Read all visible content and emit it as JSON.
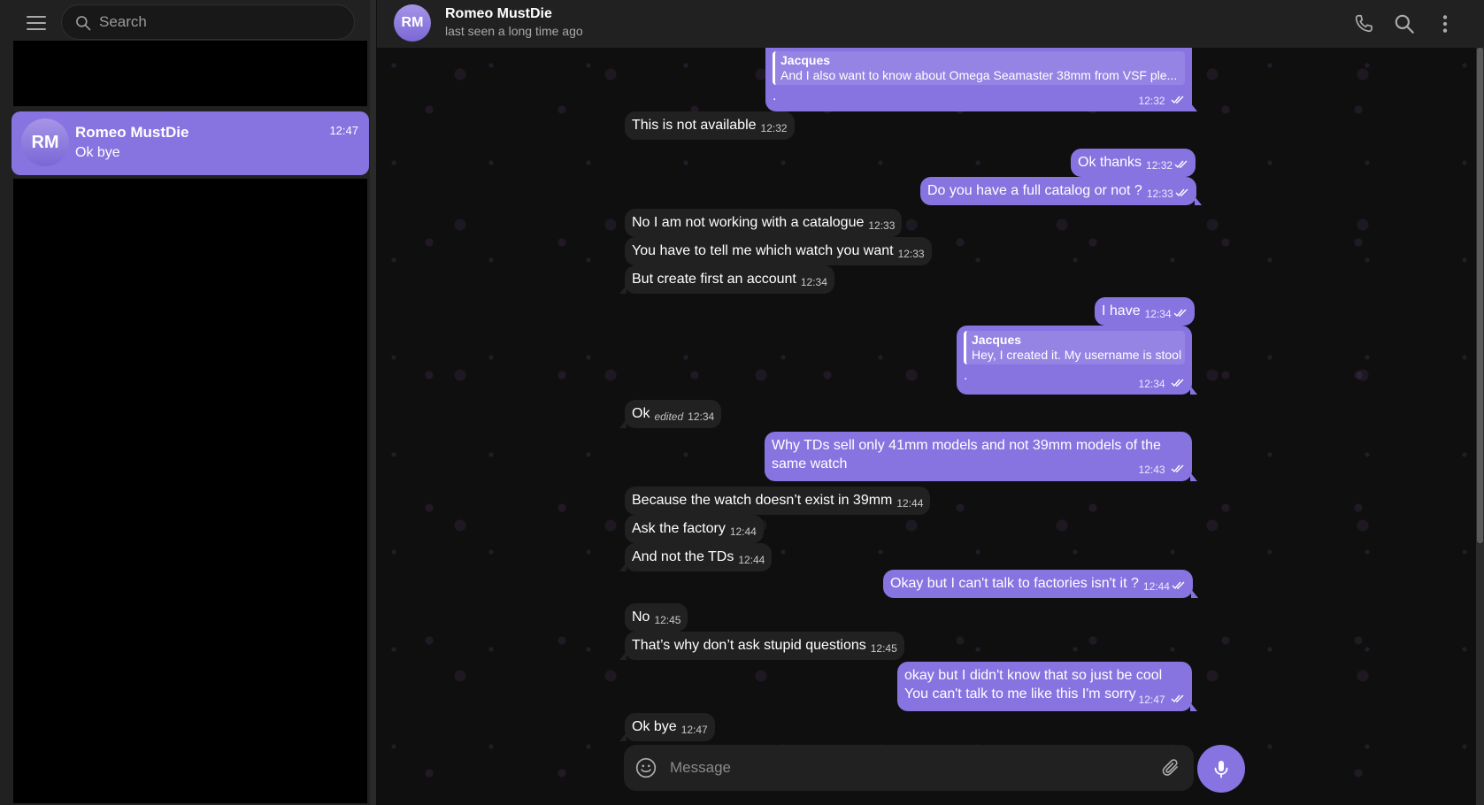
{
  "sidebar": {
    "search_placeholder": "Search",
    "chats": [
      {
        "initials": "RM",
        "name": "Romeo MustDie",
        "time": "12:47",
        "preview": "Ok bye"
      }
    ]
  },
  "header": {
    "initials": "RM",
    "title": "Romeo MustDie",
    "status": "last seen a long time ago"
  },
  "messages": [
    {
      "dir": "out",
      "reply_name": "Jacques",
      "reply_text": "And I also want to know about Omega Seamaster 38mm from VSF ple...",
      "text": ".",
      "time": "12:32"
    },
    {
      "dir": "in",
      "text": "This is not available",
      "time": "12:32"
    },
    {
      "dir": "out",
      "text": "Ok thanks",
      "time": "12:32"
    },
    {
      "dir": "out",
      "text": "Do you have a full catalog or not ?",
      "time": "12:33"
    },
    {
      "dir": "in",
      "text": "No I am not working with a catalogue",
      "time": "12:33"
    },
    {
      "dir": "in",
      "text": "You have to tell me which watch you want",
      "time": "12:33"
    },
    {
      "dir": "in",
      "text": "But create first an account",
      "time": "12:34"
    },
    {
      "dir": "out",
      "text": "I have",
      "time": "12:34"
    },
    {
      "dir": "out",
      "reply_name": "Jacques",
      "reply_text": "Hey, I created it. My username is stool",
      "text": ".",
      "time": "12:34"
    },
    {
      "dir": "in",
      "text": "Ok",
      "edited": "edited",
      "time": "12:34"
    },
    {
      "dir": "out",
      "text_line1": "Why TDs sell only 41mm models and not 39mm models of the",
      "text_line2": "same watch",
      "time": "12:43"
    },
    {
      "dir": "in",
      "text": "Because the watch doesn’t exist in 39mm",
      "time": "12:44"
    },
    {
      "dir": "in",
      "text": "Ask the factory",
      "time": "12:44"
    },
    {
      "dir": "in",
      "text": "And not the TDs",
      "time": "12:44"
    },
    {
      "dir": "out",
      "text": "Okay but I can't talk to factories isn't it ?",
      "time": "12:44"
    },
    {
      "dir": "in",
      "text": "No",
      "time": "12:45"
    },
    {
      "dir": "in",
      "text": "That’s why don’t ask stupid questions",
      "time": "12:45"
    },
    {
      "dir": "out",
      "text_line1": "okay but I didn't know that so just be cool",
      "text_line2": "You can't talk to me like this I'm sorry",
      "time": "12:47"
    },
    {
      "dir": "in",
      "text": "Ok bye",
      "time": "12:47"
    }
  ],
  "composer": {
    "placeholder": "Message"
  },
  "icons": {
    "menu": "hamburger-menu-icon",
    "search": "search-icon",
    "call": "phone-icon",
    "more": "more-vertical-icon",
    "emoji": "emoji-smile-icon",
    "attach": "paperclip-icon",
    "mic": "microphone-icon"
  },
  "colors": {
    "accent": "#8774e1",
    "incoming_bubble": "#212121",
    "panel": "#212121",
    "background": "#0f0f0f"
  }
}
